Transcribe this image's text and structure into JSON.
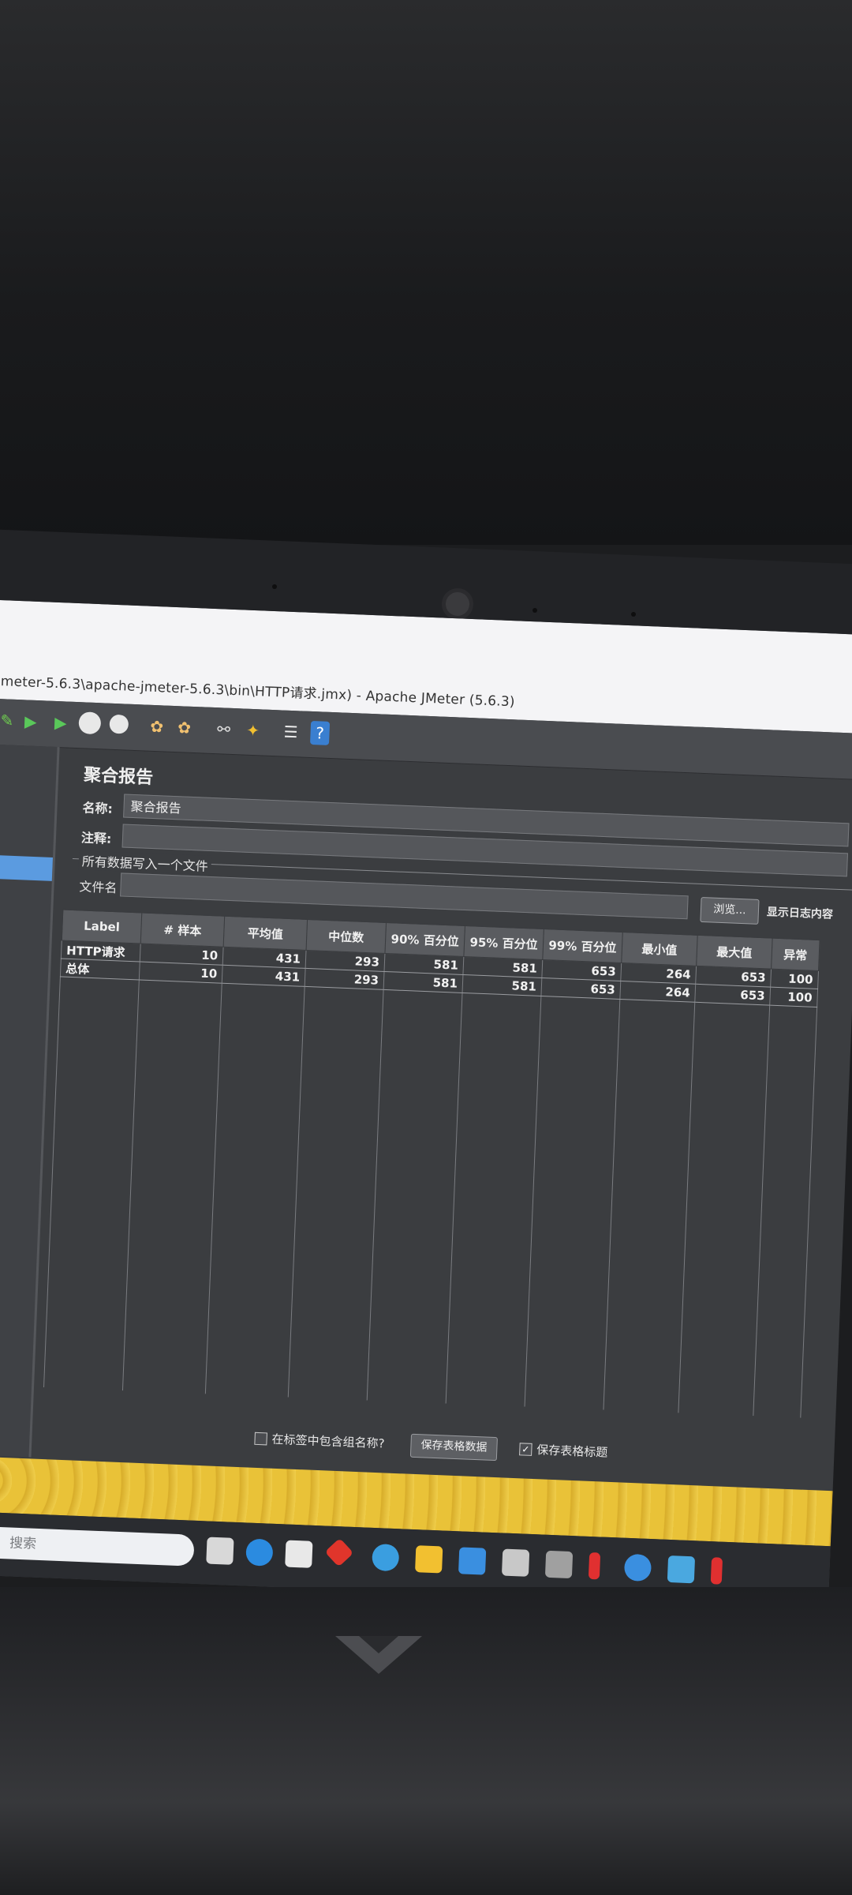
{
  "window": {
    "title": "jmeter-5.6.3\\apache-jmeter-5.6.3\\bin\\HTTP请求.jmx) - Apache JMeter (5.6.3)"
  },
  "panel": {
    "heading": "聚合报告",
    "name_label": "名称:",
    "name_value": "聚合报告",
    "comment_label": "注释:",
    "comment_value": "",
    "group_title": "所有数据写入一个文件",
    "filename_label": "文件名",
    "filename_value": "",
    "browse_label": "浏览...",
    "log_option_label": "显示日志内容"
  },
  "table": {
    "columns": [
      "Label",
      "# 样本",
      "平均值",
      "中位数",
      "90% 百分位",
      "95% 百分位",
      "99% 百分位",
      "最小值",
      "最大值",
      "异常"
    ],
    "rows": [
      [
        "HTTP请求",
        "10",
        "431",
        "293",
        "581",
        "581",
        "653",
        "264",
        "653",
        "100"
      ],
      [
        "总体",
        "10",
        "431",
        "293",
        "581",
        "581",
        "653",
        "264",
        "653",
        "100"
      ]
    ]
  },
  "footer": {
    "include_group_label": "在标签中包含组名称?",
    "save_table_data": "保存表格数据",
    "save_table_header": "保存表格标题"
  },
  "taskbar": {
    "search_placeholder": "搜索"
  },
  "colors": {
    "selection": "#5b9be0",
    "wallpaper": "#e9c238"
  }
}
